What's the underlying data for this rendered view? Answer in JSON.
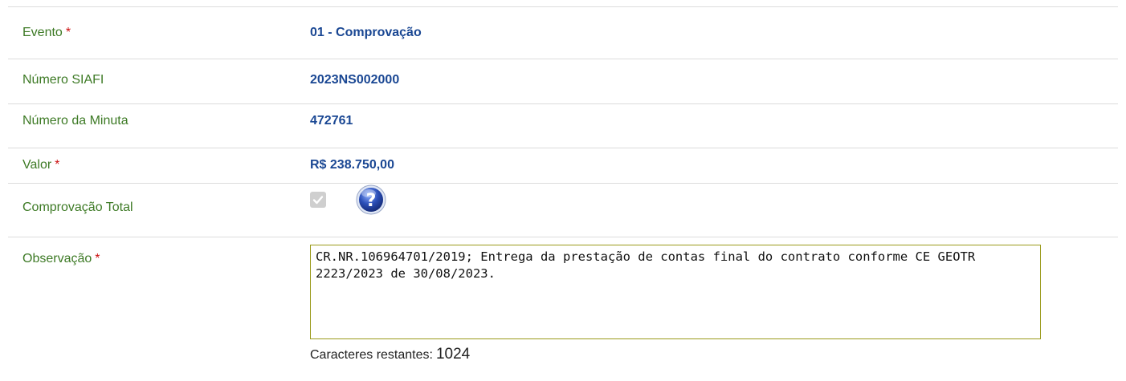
{
  "form": {
    "rows": [
      {
        "label": "Evento",
        "required": "*",
        "value": "01 - Comprovação"
      },
      {
        "label": "Número SIAFI",
        "value": "2023NS002000"
      },
      {
        "label": "Número da Minuta",
        "value": "472761"
      },
      {
        "label": "Valor",
        "required": "*",
        "value": "R$ 238.750,00"
      },
      {
        "label": "Comprovação Total",
        "checkbox_checked": true,
        "checkbox_disabled": true,
        "help_icon": "question-mark-help-icon"
      },
      {
        "label": "Observação",
        "required": "*",
        "textarea_value": "CR.NR.106964701/2019; Entrega da prestação de contas final do contrato conforme CE GEOTR 2223/2023 de 30/08/2023."
      }
    ],
    "counter": {
      "label": "Caracteres restantes:",
      "value": "1024"
    }
  },
  "colors": {
    "label": "#3d7a25",
    "value": "#1a4793",
    "required": "#cc1111",
    "textarea_border": "#9a9a1a",
    "help_icon": "#2b4fb8"
  }
}
